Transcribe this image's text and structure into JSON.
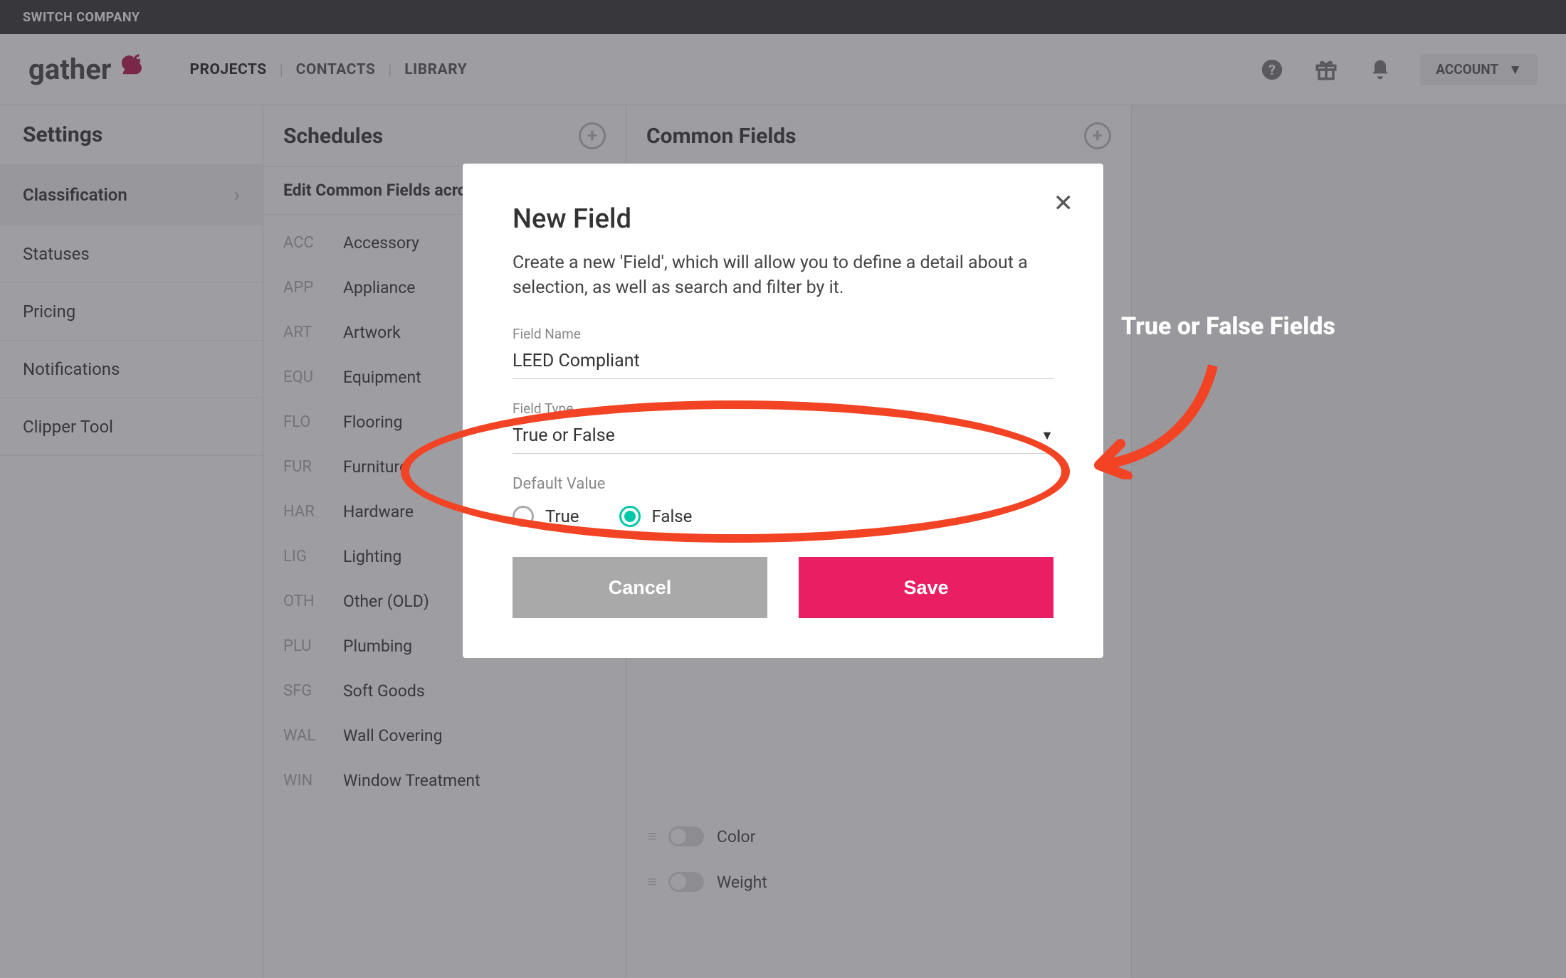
{
  "topbar": {
    "switch_company": "SWITCH COMPANY"
  },
  "logo": {
    "text": "gather"
  },
  "nav": {
    "projects": "PROJECTS",
    "contacts": "CONTACTS",
    "library": "LIBRARY"
  },
  "account": {
    "label": "ACCOUNT"
  },
  "sidebar": {
    "title": "Settings",
    "items": [
      {
        "label": "Classification"
      },
      {
        "label": "Statuses"
      },
      {
        "label": "Pricing"
      },
      {
        "label": "Notifications"
      },
      {
        "label": "Clipper Tool"
      }
    ]
  },
  "schedules": {
    "title": "Schedules",
    "subtitle": "Edit Common Fields across all Schedules",
    "rows": [
      {
        "code": "ACC",
        "name": "Accessory"
      },
      {
        "code": "APP",
        "name": "Appliance"
      },
      {
        "code": "ART",
        "name": "Artwork"
      },
      {
        "code": "EQU",
        "name": "Equipment"
      },
      {
        "code": "FLO",
        "name": "Flooring"
      },
      {
        "code": "FUR",
        "name": "Furniture"
      },
      {
        "code": "HAR",
        "name": "Hardware"
      },
      {
        "code": "LIG",
        "name": "Lighting"
      },
      {
        "code": "OTH",
        "name": "Other (OLD)"
      },
      {
        "code": "PLU",
        "name": "Plumbing"
      },
      {
        "code": "SFG",
        "name": "Soft Goods"
      },
      {
        "code": "WAL",
        "name": "Wall Covering"
      },
      {
        "code": "WIN",
        "name": "Window Treatment"
      }
    ]
  },
  "common_fields": {
    "title": "Common Fields",
    "rows": [
      {
        "label": "Color"
      },
      {
        "label": "Weight"
      }
    ]
  },
  "modal": {
    "title": "New Field",
    "desc": "Create a new 'Field', which will allow you to define a detail about a selection, as well as search and filter by it.",
    "field_name_label": "Field Name",
    "field_name_value": "LEED Compliant",
    "field_type_label": "Field Type",
    "field_type_value": "True or False",
    "default_value_label": "Default Value",
    "true_label": "True",
    "false_label": "False",
    "cancel": "Cancel",
    "save": "Save"
  },
  "annotation": {
    "text": "True or False Fields"
  }
}
